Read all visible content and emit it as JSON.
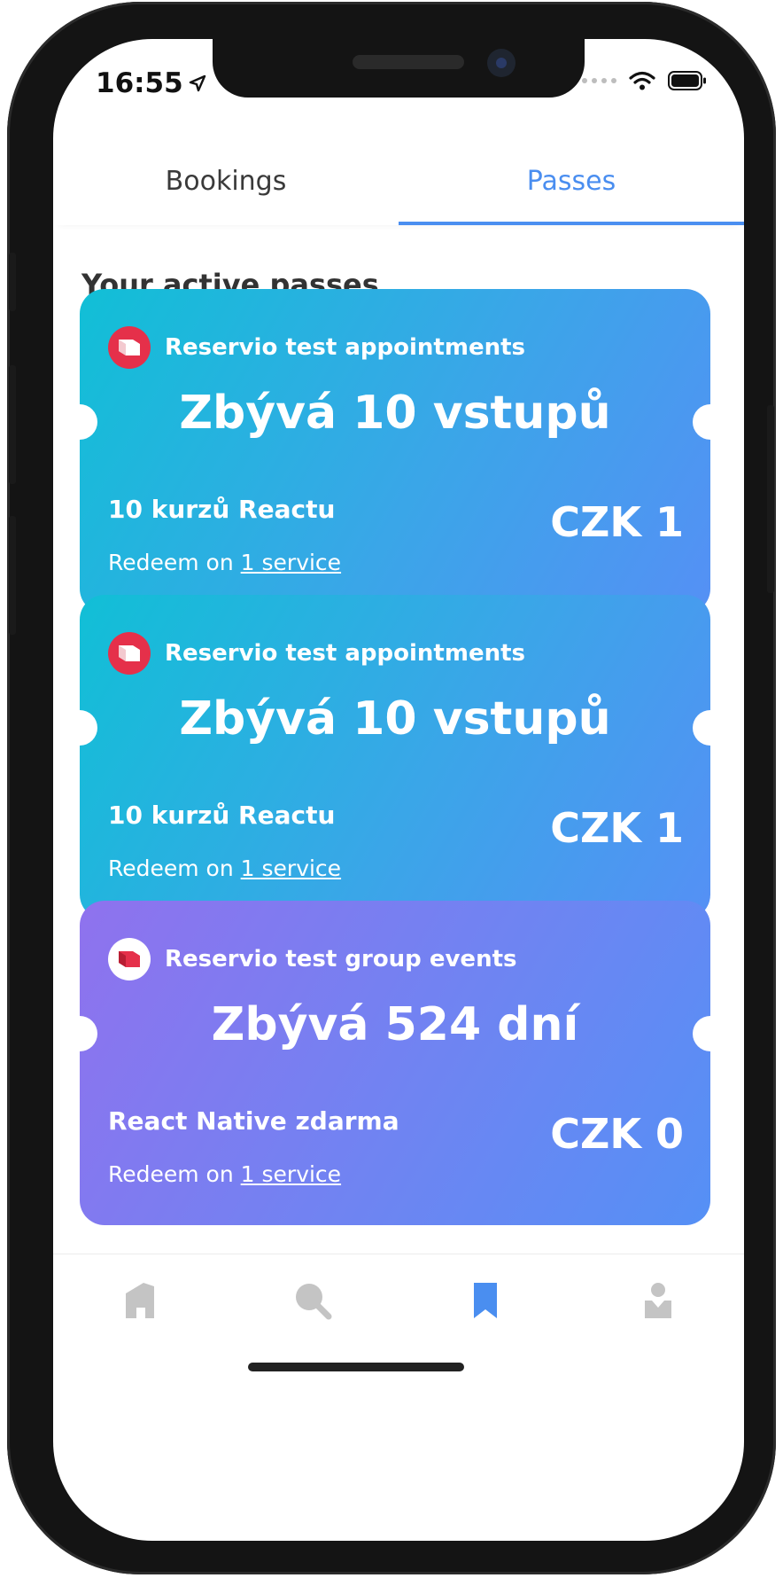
{
  "status_bar": {
    "time": "16:55"
  },
  "tabs": [
    {
      "label": "Bookings",
      "active": false
    },
    {
      "label": "Passes",
      "active": true
    }
  ],
  "section_title": "Your active passes",
  "passes": [
    {
      "provider": "Reservio test appointments",
      "remaining": "Zbývá 10 vstupů",
      "name": "10 kurzů Reactu",
      "price": "CZK 1",
      "redeem_prefix": "Redeem on",
      "redeem_link": "1 service",
      "theme": "teal"
    },
    {
      "provider": "Reservio test appointments",
      "remaining": "Zbývá 10 vstupů",
      "name": "10 kurzů Reactu",
      "price": "CZK 1",
      "redeem_prefix": "Redeem on",
      "redeem_link": "1 service",
      "theme": "teal"
    },
    {
      "provider": "Reservio test group events",
      "remaining": "Zbývá 524 dní",
      "name": "React Native zdarma",
      "price": "CZK 0",
      "redeem_prefix": "Redeem on",
      "redeem_link": "1 service",
      "theme": "violet"
    }
  ],
  "bottom_nav": [
    {
      "icon": "home-icon",
      "active": false
    },
    {
      "icon": "search-icon",
      "active": false
    },
    {
      "icon": "bookmark-icon",
      "active": true
    },
    {
      "icon": "profile-icon",
      "active": false
    }
  ],
  "colors": {
    "accent": "#4a8ef0",
    "teal_gradient_start": "#11bfd6",
    "violet_gradient_start": "#8f72ee",
    "gradient_end": "#5590f5",
    "logo_red": "#e5304a",
    "nav_inactive": "#c4c4c4"
  }
}
